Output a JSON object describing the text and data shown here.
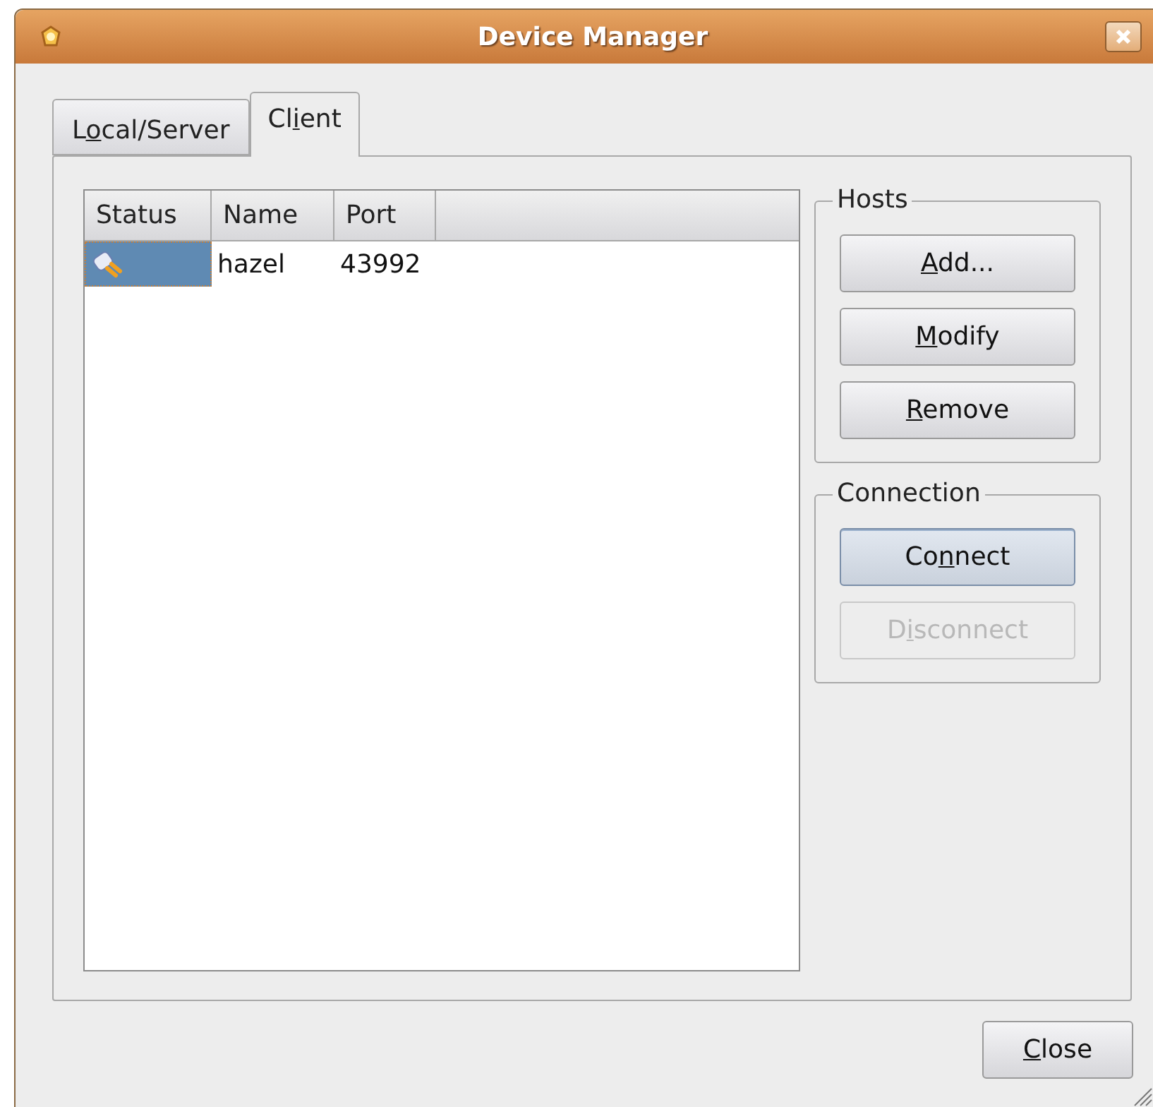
{
  "window": {
    "title": "Device Manager"
  },
  "tabs": [
    {
      "label": {
        "pre": "L",
        "key": "o",
        "post": "cal/Server"
      },
      "selected": false
    },
    {
      "label": {
        "pre": "Cl",
        "key": "i",
        "post": "ent"
      },
      "selected": true
    }
  ],
  "table": {
    "columns": [
      "Status",
      "Name",
      "Port"
    ],
    "rows": [
      {
        "connected": true,
        "name": "hazel",
        "port": "43992",
        "selected": true
      }
    ]
  },
  "hosts": {
    "title": "Hosts",
    "buttons": [
      {
        "key": "A",
        "post": "dd...",
        "disabled": false,
        "focused": false
      },
      {
        "key": "M",
        "post": "odify",
        "disabled": false,
        "focused": false
      },
      {
        "key": "R",
        "post": "emove",
        "disabled": false,
        "focused": false
      }
    ]
  },
  "connection": {
    "title": "Connection",
    "buttons": [
      {
        "pre": "Co",
        "key": "n",
        "post": "nect",
        "disabled": false,
        "focused": true
      },
      {
        "pre": "D",
        "key": "i",
        "post": "sconnect",
        "disabled": true,
        "focused": false
      }
    ]
  },
  "close_button": {
    "key": "C",
    "post": "lose"
  }
}
